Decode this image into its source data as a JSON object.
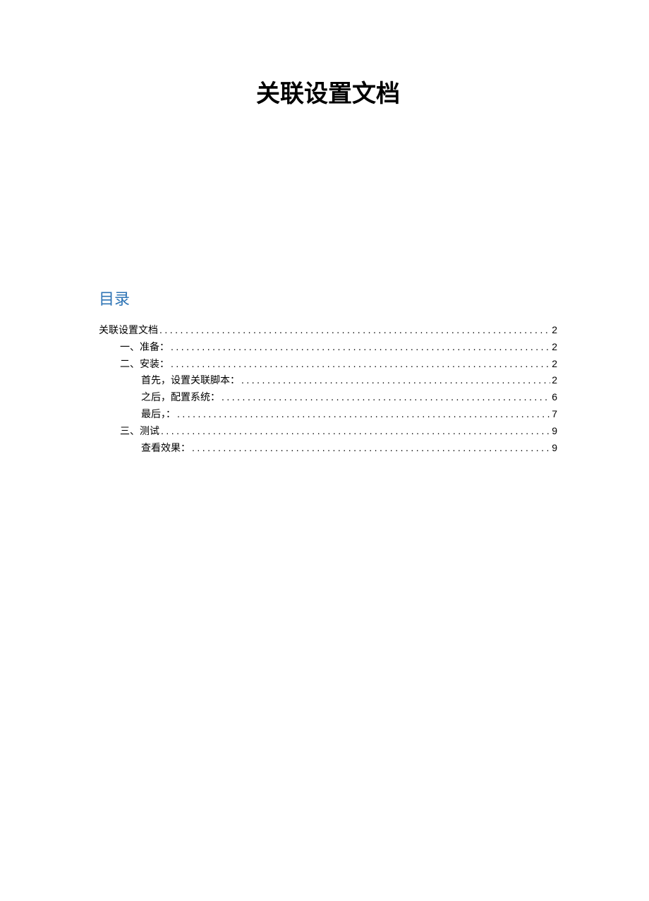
{
  "title": "关联设置文档",
  "toc_heading": "目录",
  "toc": [
    {
      "level": 1,
      "label": "关联设置文档",
      "page": "2"
    },
    {
      "level": 2,
      "label": "一、准备：",
      "page": "2"
    },
    {
      "level": 2,
      "label": "二、安装：",
      "page": "2"
    },
    {
      "level": 3,
      "label": "首先，设置关联脚本：",
      "page": "2"
    },
    {
      "level": 3,
      "label": "之后，配置系统：",
      "page": "6"
    },
    {
      "level": 3,
      "label": "最后，：",
      "page": "7"
    },
    {
      "level": 2,
      "label": "三、测试",
      "page": "9"
    },
    {
      "level": 3,
      "label": "查看效果：",
      "page": "9"
    }
  ]
}
